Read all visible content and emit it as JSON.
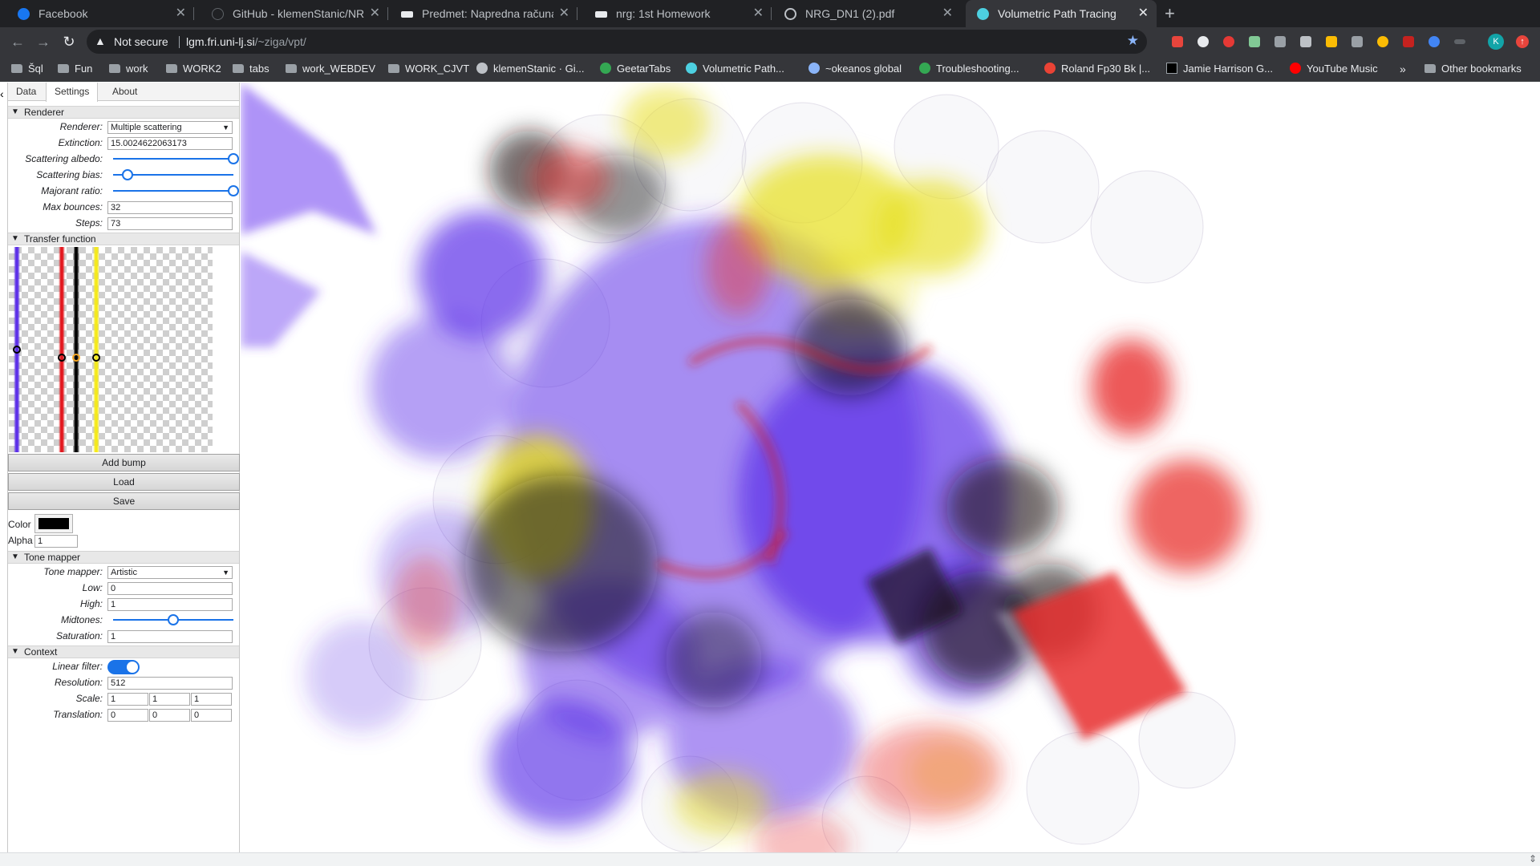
{
  "browser": {
    "tabs": [
      {
        "title": "Facebook",
        "favicon": "facebook-icon",
        "color": "#1877f2",
        "active": false
      },
      {
        "title": "GitHub - klemenStanic/NRG-H",
        "favicon": "github-icon",
        "color": "#202124",
        "active": false
      },
      {
        "title": "Predmet: Napredna računalnišk",
        "favicon": "moodle-icon",
        "color": "#e8eaed",
        "active": false
      },
      {
        "title": "nrg: 1st Homework",
        "favicon": "moodle-icon",
        "color": "#e8eaed",
        "active": false
      },
      {
        "title": "NRG_DN1 (2).pdf",
        "favicon": "globe-icon",
        "color": "#bdc1c6",
        "active": false
      },
      {
        "title": "Volumetric Path Tracing",
        "favicon": "vpt-icon",
        "color": "#4dd0e1",
        "active": true
      }
    ],
    "new_tab": "+",
    "close_glyph": "✕",
    "address": {
      "security": "Not secure",
      "host": "lgm.fri.uni-lj.si",
      "path": "/~ziga/vpt/"
    },
    "profile_initial": "K",
    "bookmarks": [
      {
        "label": "Šql",
        "icon": "folder"
      },
      {
        "label": "Fun",
        "icon": "folder"
      },
      {
        "label": "work",
        "icon": "folder"
      },
      {
        "label": "WORK2",
        "icon": "folder"
      },
      {
        "label": "tabs",
        "icon": "folder"
      },
      {
        "label": "work_WEBDEV",
        "icon": "folder"
      },
      {
        "label": "WORK_CJVT",
        "icon": "folder"
      },
      {
        "label": "klemenStanic · Gi...",
        "icon": "github",
        "color": "#bdc1c6"
      },
      {
        "label": "GeetarTabs",
        "icon": "v",
        "color": "#34a853"
      },
      {
        "label": "Volumetric Path...",
        "icon": "vpt",
        "color": "#4dd0e1"
      },
      {
        "label": "~okeanos global",
        "icon": "okeanos",
        "color": "#8ab4f8"
      },
      {
        "label": "Troubleshooting...",
        "icon": "troubleshoot",
        "color": "#34a853"
      },
      {
        "label": "Roland Fp30 Bk |...",
        "icon": "roland",
        "color": "#ea4335"
      },
      {
        "label": "Jamie Harrison G...",
        "icon": "jamie",
        "color": "#000000"
      },
      {
        "label": "YouTube Music",
        "icon": "ytmusic",
        "color": "#ff0000"
      }
    ],
    "bookmarks_more": "»",
    "other_bookmarks": "Other bookmarks"
  },
  "app": {
    "tabs": [
      "Data",
      "Settings",
      "About"
    ],
    "active_tab": "Settings",
    "renderer": {
      "title": "Renderer",
      "renderer_label": "Renderer:",
      "renderer_value": "Multiple scattering",
      "extinction_label": "Extinction:",
      "extinction_value": "15.0024622063173",
      "albedo_label": "Scattering albedo:",
      "albedo_value": 1.0,
      "bias_label": "Scattering bias:",
      "bias_value": 0.12,
      "majorant_label": "Majorant ratio:",
      "majorant_value": 1.0,
      "bounces_label": "Max bounces:",
      "bounces_value": "32",
      "steps_label": "Steps:",
      "steps_value": "73"
    },
    "transfer": {
      "title": "Transfer function",
      "bumps": [
        {
          "pos": 0.04,
          "color": "#5b2ee8"
        },
        {
          "pos": 0.26,
          "color": "#e3161d"
        },
        {
          "pos": 0.33,
          "color": "#000000"
        },
        {
          "pos": 0.43,
          "color": "#f5ea18"
        }
      ],
      "add_bump": "Add bump",
      "load": "Load",
      "save": "Save",
      "color_label": "Color",
      "color_value": "#000000",
      "alpha_label": "Alpha",
      "alpha_value": "1"
    },
    "tone": {
      "title": "Tone mapper",
      "mapper_label": "Tone mapper:",
      "mapper_value": "Artistic",
      "low_label": "Low:",
      "low_value": "0",
      "high_label": "High:",
      "high_value": "1",
      "midtones_label": "Midtones:",
      "midtones_value": 0.5,
      "saturation_label": "Saturation:",
      "saturation_value": "1"
    },
    "context": {
      "title": "Context",
      "filter_label": "Linear filter:",
      "filter_on": true,
      "resolution_label": "Resolution:",
      "resolution_value": "512",
      "scale_label": "Scale:",
      "scale_values": [
        "1",
        "1",
        "1"
      ],
      "translation_label": "Translation:",
      "translation_values": [
        "0",
        "0",
        "0"
      ]
    }
  },
  "colors": {
    "purple": "#5b2ee8",
    "red": "#e8302f",
    "yellow": "#e7df1e",
    "black": "#1a1418",
    "accent": "#1a73e8"
  }
}
